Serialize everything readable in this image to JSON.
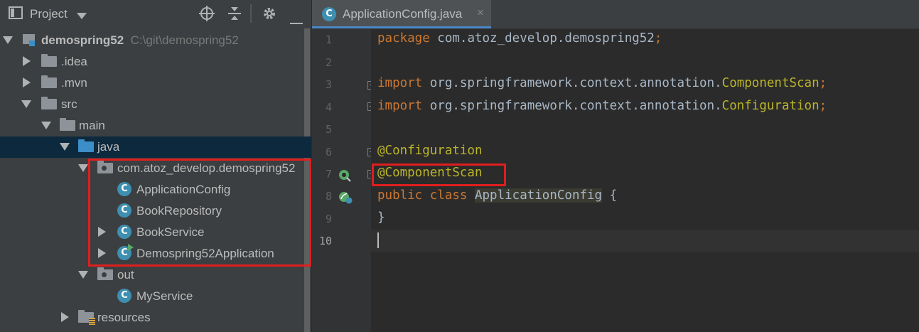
{
  "project_panel": {
    "title": "Project",
    "tree": [
      {
        "label": "demospring52",
        "path": "C:\\git\\demospring52"
      },
      {
        "label": ".idea"
      },
      {
        "label": ".mvn"
      },
      {
        "label": "src"
      },
      {
        "label": "main"
      },
      {
        "label": "java"
      },
      {
        "label": "com.atoz_develop.demospring52"
      },
      {
        "label": "ApplicationConfig"
      },
      {
        "label": "BookRepository"
      },
      {
        "label": "BookService"
      },
      {
        "label": "Demospring52Application"
      },
      {
        "label": "out"
      },
      {
        "label": "MyService"
      },
      {
        "label": "resources"
      }
    ]
  },
  "editor": {
    "tab": {
      "label": "ApplicationConfig.java",
      "close": "×"
    },
    "line_numbers": [
      "1",
      "2",
      "3",
      "4",
      "5",
      "6",
      "7",
      "8",
      "9",
      "10"
    ],
    "lines": {
      "l1_kw": "package",
      "l1_rest": " com.atoz_develop.demospring52",
      "l1_semi": ";",
      "l3_kw": "import",
      "l3_pkg": " org.springframework.context.annotation.",
      "l3_cls": "ComponentScan",
      "l3_semi": ";",
      "l4_kw": "import",
      "l4_pkg": " org.springframework.context.annotation.",
      "l4_cls": "Configuration",
      "l4_semi": ";",
      "l6_ann": "@Configuration",
      "l7_ann": "@ComponentScan",
      "l8_kw": "public class",
      "l8_name": "ApplicationConfig",
      "l8_brace": " {",
      "l9": "}"
    }
  },
  "colors": {
    "keyword": "#CC7832",
    "annotation": "#BBB529",
    "text": "#A9B7C6",
    "highlight_box": "#E01E1E",
    "selection": "#0D293E"
  }
}
